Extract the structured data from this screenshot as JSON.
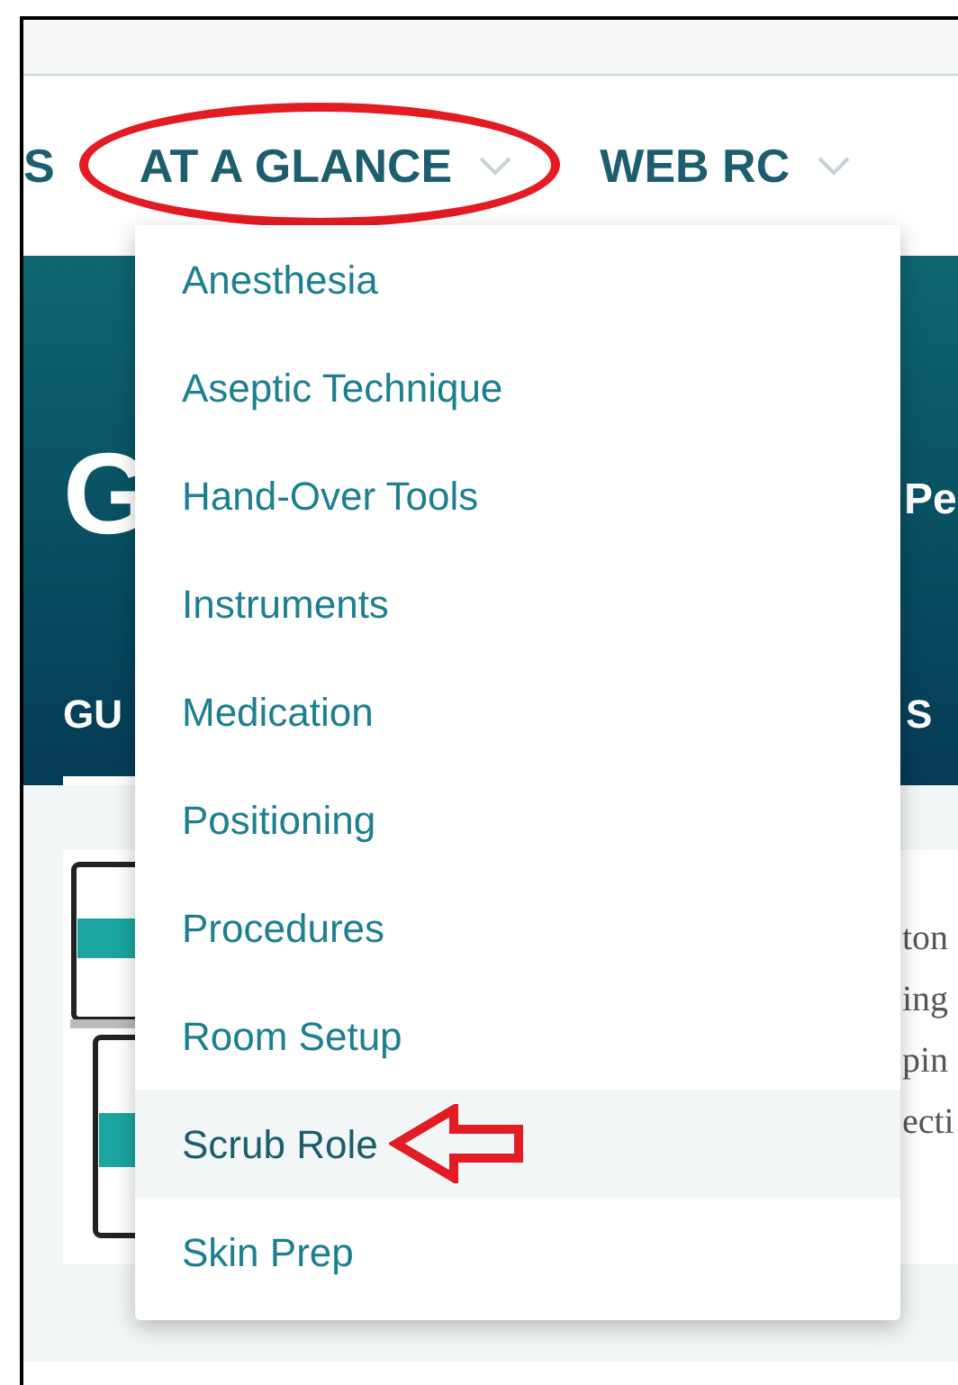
{
  "nav": {
    "items": [
      {
        "label": "S",
        "has_chevron": false,
        "circled": false
      },
      {
        "label": "AT A GLANCE",
        "has_chevron": true,
        "circled": true
      },
      {
        "label": "WEB RC",
        "has_chevron": true,
        "circled": false
      }
    ]
  },
  "hero": {
    "title_left": "G",
    "title_right": "Pe",
    "tabs": [
      {
        "label": "GU",
        "selected": true
      },
      {
        "label": "S",
        "selected": false
      }
    ]
  },
  "card": {
    "text_lines": [
      "ton",
      "ing",
      "pin",
      "ecti"
    ]
  },
  "dropdown": {
    "items": [
      {
        "label": "Anesthesia",
        "selected": false,
        "arrowed": false
      },
      {
        "label": "Aseptic Technique",
        "selected": false,
        "arrowed": false
      },
      {
        "label": "Hand-Over Tools",
        "selected": false,
        "arrowed": false
      },
      {
        "label": "Instruments",
        "selected": false,
        "arrowed": false
      },
      {
        "label": "Medication",
        "selected": false,
        "arrowed": false
      },
      {
        "label": "Positioning",
        "selected": false,
        "arrowed": false
      },
      {
        "label": "Procedures",
        "selected": false,
        "arrowed": false
      },
      {
        "label": "Room Setup",
        "selected": false,
        "arrowed": false
      },
      {
        "label": "Scrub Role",
        "selected": true,
        "arrowed": true
      },
      {
        "label": "Skin Prep",
        "selected": false,
        "arrowed": false
      }
    ]
  }
}
